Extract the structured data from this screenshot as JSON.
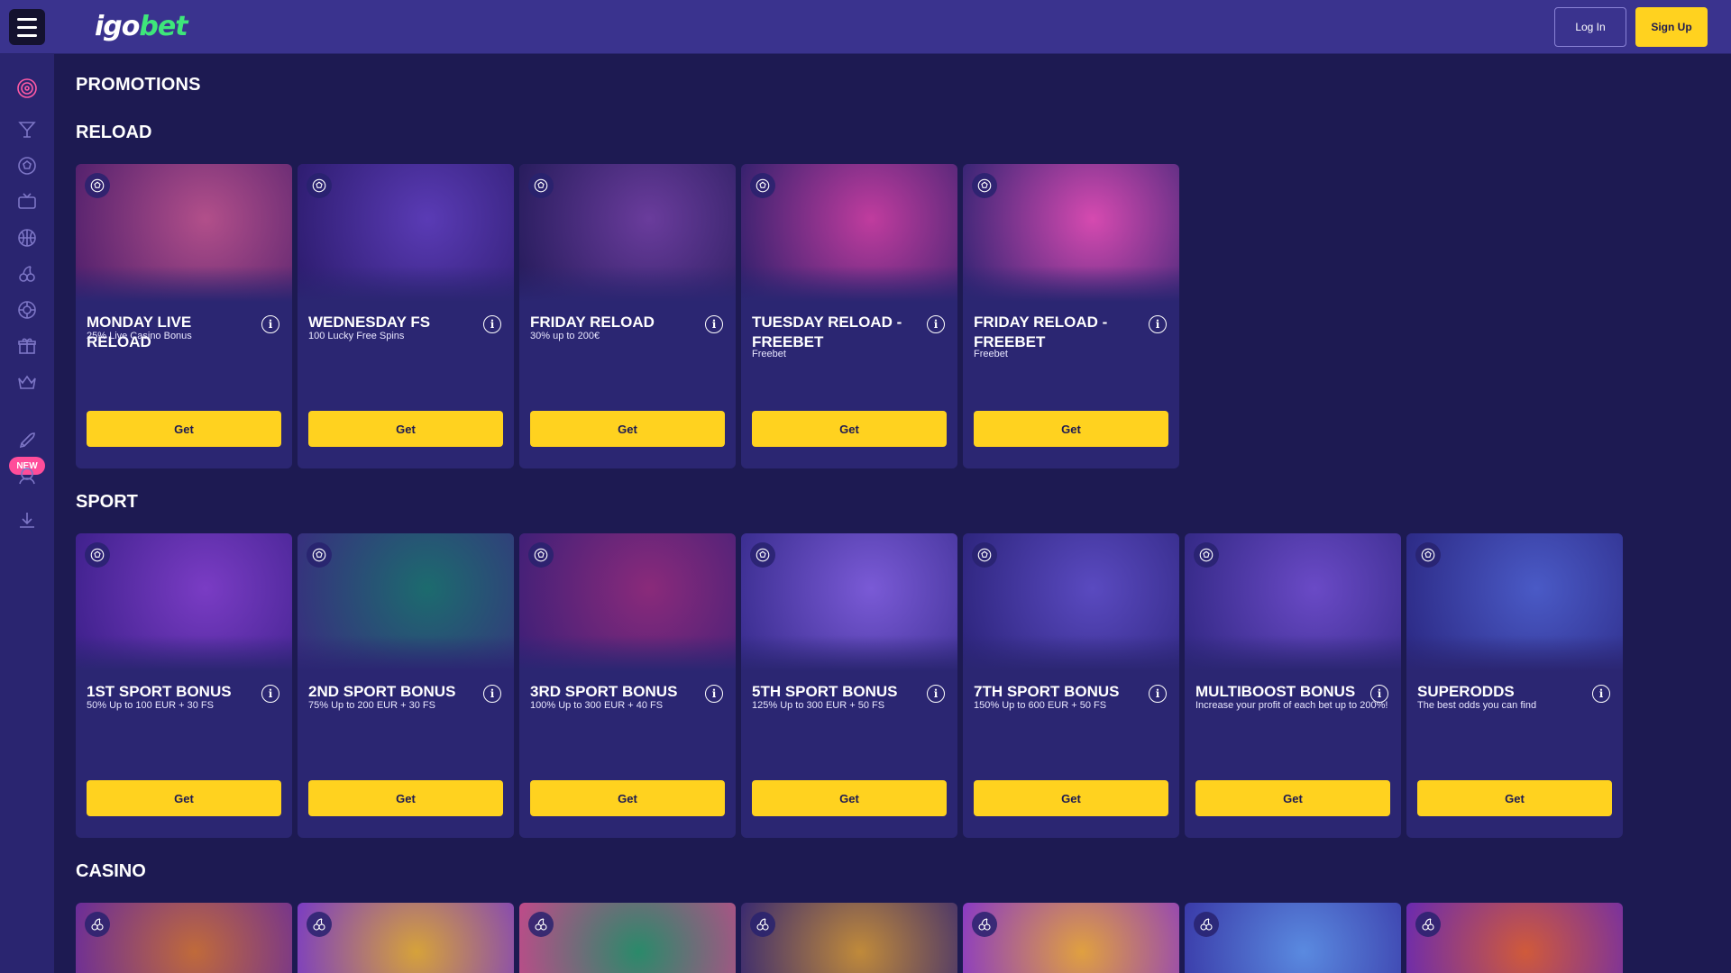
{
  "header": {
    "logo_igo": "igo",
    "logo_bet": "bet",
    "login_label": "Log In",
    "signup_label": "Sign Up"
  },
  "sidebar": {
    "items": [
      {
        "icon": "target-icon",
        "active": true
      },
      {
        "icon": "cocktail-icon"
      },
      {
        "icon": "football-icon"
      },
      {
        "icon": "tv-icon"
      },
      {
        "icon": "basketball-icon"
      },
      {
        "icon": "cherries-icon"
      },
      {
        "icon": "roulette-icon"
      },
      {
        "icon": "gift-icon"
      },
      {
        "icon": "crown-icon"
      },
      {
        "icon": "rocket-icon"
      },
      {
        "icon": "support-icon"
      },
      {
        "icon": "download-icon"
      }
    ],
    "new_badge": "NEW"
  },
  "page_title": "PROMOTIONS",
  "sections": {
    "reload": {
      "title": "RELOAD",
      "cards": [
        {
          "name": "MONDAY LIVE RELOAD",
          "desc": "25% Live Casino Bonus",
          "button": "Get",
          "bg": [
            "#b24f8a",
            "#4b1d6b"
          ]
        },
        {
          "name": "WEDNESDAY FS",
          "desc": "100 Lucky Free Spins",
          "button": "Get",
          "bg": [
            "#5a3bb5",
            "#2a1a6a"
          ]
        },
        {
          "name": "FRIDAY RELOAD",
          "desc": "30% up to 200€",
          "button": "Get",
          "bg": [
            "#6a3c9c",
            "#221a58"
          ]
        },
        {
          "name": "TUESDAY RELOAD - FREEBET",
          "desc": "Freebet",
          "button": "Get",
          "bg": [
            "#c03c9e",
            "#2a1f6a"
          ]
        },
        {
          "name": "FRIDAY RELOAD - FREEBET",
          "desc": "Freebet",
          "button": "Get",
          "bg": [
            "#d64ab0",
            "#2a2270"
          ]
        }
      ]
    },
    "sport": {
      "title": "SPORT",
      "cards": [
        {
          "name": "1ST SPORT BONUS",
          "desc": "50% Up to 100 EUR + 30 FS",
          "button": "Get",
          "bg": [
            "#7a3cc4",
            "#3a1f88"
          ]
        },
        {
          "name": "2ND SPORT BONUS",
          "desc": "75% Up to 200 EUR + 30 FS",
          "button": "Get",
          "bg": [
            "#1c6b6e",
            "#3a2a80"
          ]
        },
        {
          "name": "3RD SPORT BONUS",
          "desc": "100% Up to 300 EUR + 40 FS",
          "button": "Get",
          "bg": [
            "#8a2a7a",
            "#3a1f78"
          ]
        },
        {
          "name": "5TH SPORT BONUS",
          "desc": "125% Up to 300 EUR + 50 FS",
          "button": "Get",
          "bg": [
            "#7a5ad6",
            "#352a8a"
          ]
        },
        {
          "name": "7TH SPORT BONUS",
          "desc": "150% Up to 600 EUR + 50 FS",
          "button": "Get",
          "bg": [
            "#5a4ac0",
            "#2a2278"
          ]
        },
        {
          "name": "MULTIBOOST BONUS",
          "desc": "Increase your profit of each bet up to 200%!",
          "button": "Get",
          "bg": [
            "#6a4ac6",
            "#2f2680"
          ]
        },
        {
          "name": "SUPERODDS",
          "desc": "The best odds you can find",
          "button": "Get",
          "bg": [
            "#4a5ac6",
            "#2a2680"
          ]
        }
      ]
    },
    "casino": {
      "title": "CASINO",
      "cards": [
        {
          "bg": [
            "#6a2c9a",
            "#c06a3a"
          ]
        },
        {
          "bg": [
            "#7a3cc4",
            "#d6a23a"
          ]
        },
        {
          "bg": [
            "#c04a8a",
            "#2a8a6a"
          ]
        },
        {
          "bg": [
            "#3a2a70",
            "#c08a3a"
          ]
        },
        {
          "bg": [
            "#8a3ac4",
            "#e0a040"
          ]
        },
        {
          "bg": [
            "#3a3aa8",
            "#5a8ae0"
          ]
        },
        {
          "bg": [
            "#6a2ab0",
            "#d05a3a"
          ]
        }
      ]
    }
  }
}
